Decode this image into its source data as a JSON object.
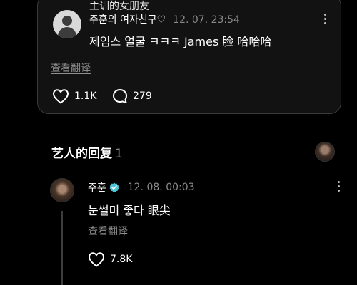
{
  "comment": {
    "avatar_icon": "default-user-avatar-icon",
    "translit_name": "主训的女朋友",
    "author": "주훈의 여자친구♡",
    "timestamp": "12. 07. 23:54",
    "text": "제임스 얼굴 ㅋㅋㅋ   James 脸 哈哈哈",
    "translate_label": "查看翻译",
    "like_count": "1.1K",
    "reply_count": "279"
  },
  "replies": {
    "title": "艺人的回复",
    "count": "1",
    "reply": {
      "author": "주훈",
      "verified_color": "#4ec3d6",
      "timestamp": "12. 08. 00:03",
      "text": "눈썰미 좋다    眼尖",
      "translate_label": "查看翻译",
      "like_count": "7.8K"
    }
  },
  "colors": {
    "background": "#000000",
    "card_background": "#121212",
    "card_border": "#3a3a3a",
    "muted_text": "#8a8a8a"
  }
}
